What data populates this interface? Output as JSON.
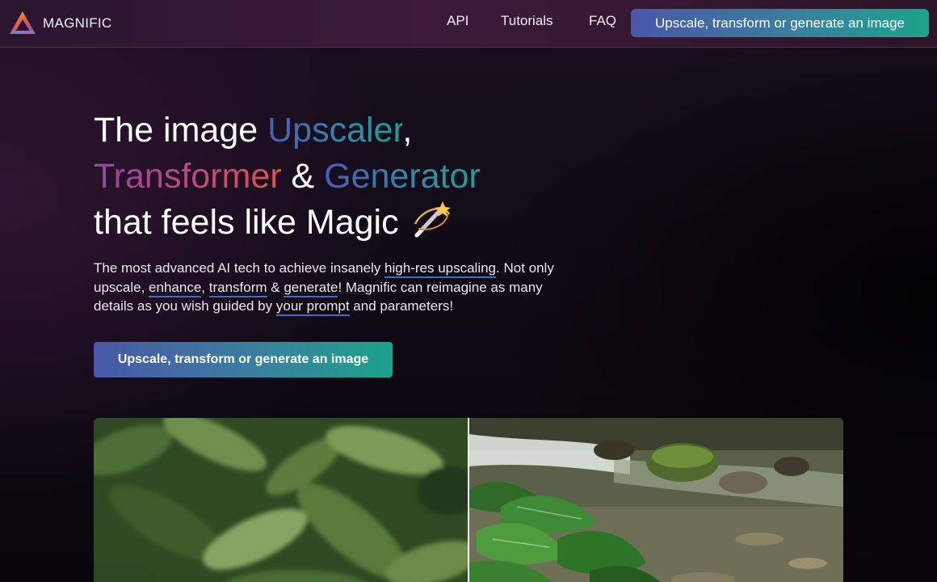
{
  "nav": {
    "brand": "MAGNIFIC",
    "links": [
      "API",
      "Tutorials",
      "FAQ"
    ],
    "cta_label": "Upscale, transform or generate an image"
  },
  "hero": {
    "title_line1_prefix": "The image ",
    "title_upscaler": "Upscaler",
    "title_line1_suffix": ",",
    "title_transformer": "Transformer",
    "title_amp": " & ",
    "title_generator": "Generator",
    "title_line3": "that feels like Magic",
    "desc_part1": "The most advanced AI tech to achieve insanely ",
    "desc_link1": "high-res upscaling",
    "desc_part2": ". Not only upscale, ",
    "desc_link2": "enhance",
    "desc_part3": ", ",
    "desc_link3": "transform",
    "desc_part4": " & ",
    "desc_link4": "generate",
    "desc_part5": "! Magnific can reimagine as many details as you wish guided by ",
    "desc_link5": "your prompt",
    "desc_part6": " and parameters!",
    "cta_label": "Upscale, transform or generate an image"
  },
  "icons": {
    "logo": "magnific-triangle-logo",
    "wand": "magic-wand-icon"
  },
  "colors": {
    "accent_start": "#4a57a9",
    "accent_end": "#1ca38a",
    "link_underline": "#3b6fc7"
  }
}
